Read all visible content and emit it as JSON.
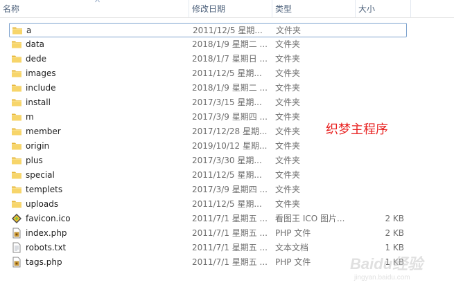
{
  "header": {
    "name": "名称",
    "date": "修改日期",
    "type": "类型",
    "size": "大小"
  },
  "files": [
    {
      "name": "a",
      "date": "2011/12/5 星期...",
      "type": "文件夹",
      "size": "",
      "icon": "folder-icon"
    },
    {
      "name": "data",
      "date": "2018/1/9 星期二 ...",
      "type": "文件夹",
      "size": "",
      "icon": "folder-icon"
    },
    {
      "name": "dede",
      "date": "2018/1/7 星期日 ...",
      "type": "文件夹",
      "size": "",
      "icon": "folder-icon"
    },
    {
      "name": "images",
      "date": "2011/12/5 星期...",
      "type": "文件夹",
      "size": "",
      "icon": "folder-icon"
    },
    {
      "name": "include",
      "date": "2018/1/9 星期二 ...",
      "type": "文件夹",
      "size": "",
      "icon": "folder-icon"
    },
    {
      "name": "install",
      "date": "2017/3/15 星期...",
      "type": "文件夹",
      "size": "",
      "icon": "folder-icon"
    },
    {
      "name": "m",
      "date": "2017/3/9 星期四 ...",
      "type": "文件夹",
      "size": "",
      "icon": "folder-icon"
    },
    {
      "name": "member",
      "date": "2017/12/28 星期...",
      "type": "文件夹",
      "size": "",
      "icon": "folder-icon"
    },
    {
      "name": "origin",
      "date": "2019/10/12 星期...",
      "type": "文件夹",
      "size": "",
      "icon": "folder-icon"
    },
    {
      "name": "plus",
      "date": "2017/3/30 星期...",
      "type": "文件夹",
      "size": "",
      "icon": "folder-icon"
    },
    {
      "name": "special",
      "date": "2011/12/5 星期...",
      "type": "文件夹",
      "size": "",
      "icon": "folder-icon"
    },
    {
      "name": "templets",
      "date": "2017/3/9 星期四 ...",
      "type": "文件夹",
      "size": "",
      "icon": "folder-icon"
    },
    {
      "name": "uploads",
      "date": "2011/12/5 星期...",
      "type": "文件夹",
      "size": "",
      "icon": "folder-icon"
    },
    {
      "name": "favicon.ico",
      "date": "2011/7/1 星期五 ...",
      "type": "看图王 ICO 图片...",
      "size": "2 KB",
      "icon": "image-file-icon"
    },
    {
      "name": "index.php",
      "date": "2011/7/1 星期五 ...",
      "type": "PHP 文件",
      "size": "2 KB",
      "icon": "php-file-icon"
    },
    {
      "name": "robots.txt",
      "date": "2011/7/1 星期五 ...",
      "type": "文本文档",
      "size": "1 KB",
      "icon": "text-file-icon"
    },
    {
      "name": "tags.php",
      "date": "2011/7/1 星期五 ...",
      "type": "PHP 文件",
      "size": "1 KB",
      "icon": "php-file-icon"
    }
  ],
  "annotation": "织梦主程序",
  "watermark": {
    "brand": "Baidu经验",
    "sub": "jingyan.baidu.com"
  }
}
